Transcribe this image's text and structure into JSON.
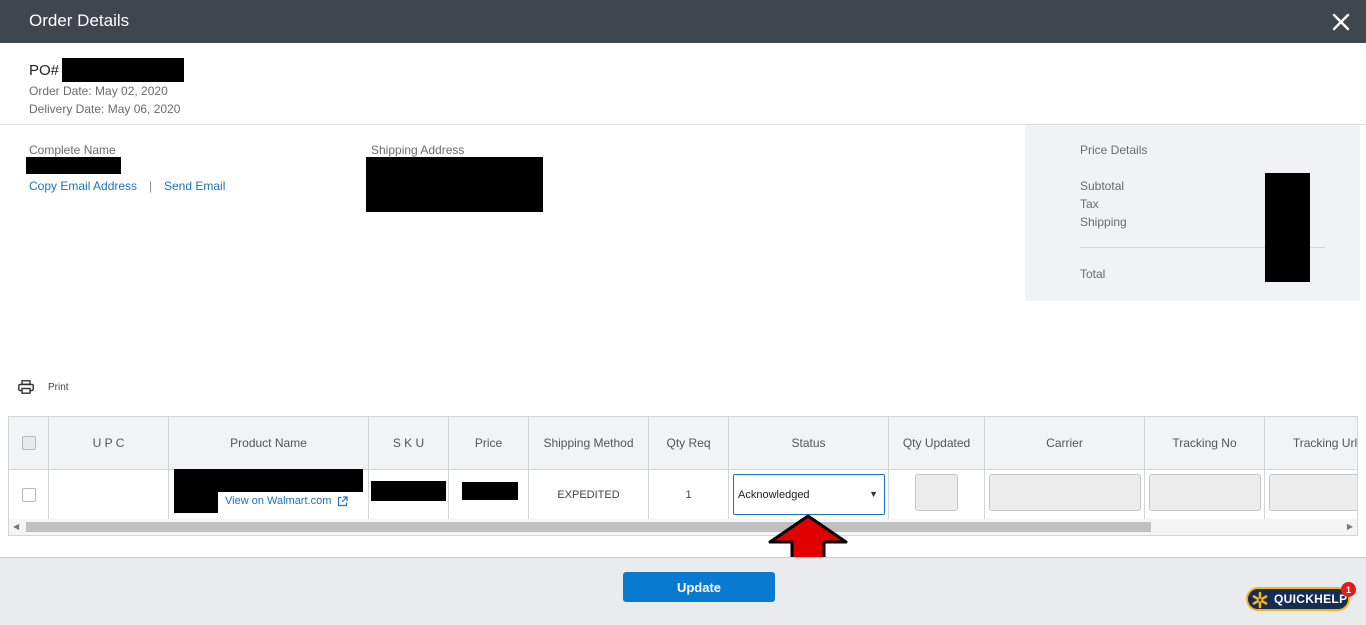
{
  "window": {
    "title": "Order Details"
  },
  "order": {
    "po_label": "PO#",
    "order_date": "Order Date: May 02, 2020",
    "delivery_date": "Delivery Date: May 06, 2020"
  },
  "customer": {
    "complete_name_label": "Complete Name",
    "copy_email_label": "Copy Email Address",
    "separator": "|",
    "send_email_label": "Send Email",
    "shipping_address_label": "Shipping Address"
  },
  "price_details": {
    "heading": "Price Details",
    "subtotal_label": "Subtotal",
    "tax_label": "Tax",
    "shipping_label": "Shipping",
    "total_label": "Total"
  },
  "toolbar": {
    "print_label": "Print"
  },
  "table": {
    "headers": {
      "upc": "U P C",
      "product_name": "Product Name",
      "sku": "S K U",
      "price": "Price",
      "shipping_method": "Shipping Method",
      "qty_req": "Qty Req",
      "status": "Status",
      "qty_updated": "Qty Updated",
      "carrier": "Carrier",
      "tracking_no": "Tracking No",
      "tracking_url": "Tracking Url"
    },
    "rows": [
      {
        "upc": "",
        "view_link": "View on Walmart.com",
        "shipping_method": "EXPEDITED",
        "qty_req": "1",
        "status": "Acknowledged"
      }
    ]
  },
  "footer": {
    "update_label": "Update"
  },
  "quickhelp": {
    "label": "QUICKHELP",
    "badge_count": "1"
  },
  "colors": {
    "titlebar": "#41464d",
    "link": "#1a73c1",
    "primary_button": "#0a7ad1",
    "annotation_arrow": "#e00000"
  }
}
